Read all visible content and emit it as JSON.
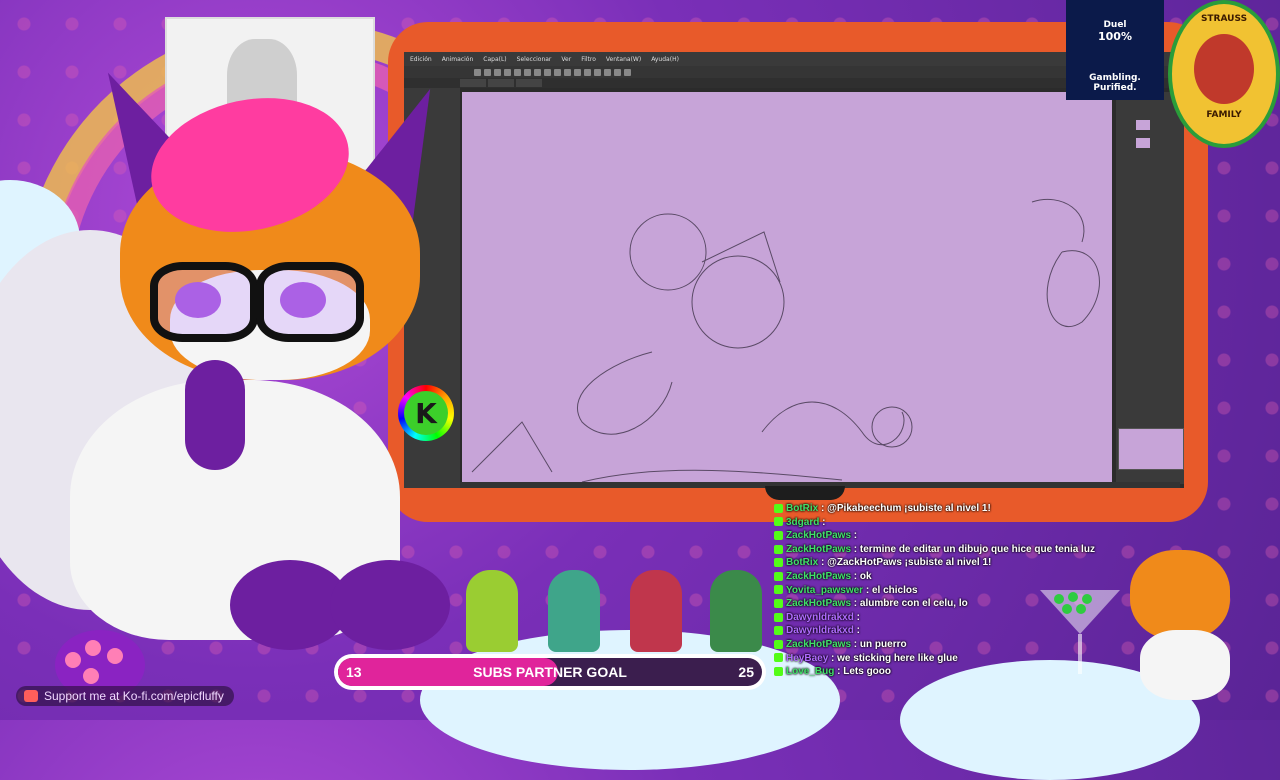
{
  "colors": {
    "accent": "#e0249b",
    "frame": "#e85a2a",
    "canvas": "#c7a4d8",
    "chat_user": "#40e06a"
  },
  "reference_card": {
    "icon": "wolf-sketch-icon"
  },
  "app": {
    "menu": [
      "Edición",
      "Animación",
      "Capa(L)",
      "Seleccionar",
      "Ver",
      "Filtro",
      "Ventana(W)",
      "Ayuda(H)"
    ]
  },
  "kick_badge": {
    "letter": "K"
  },
  "sponsor": {
    "name": "Duel",
    "percent": "100%",
    "tagline1": "Gambling.",
    "tagline2": "Purified."
  },
  "team_badge": {
    "top": "STRAUSS",
    "bottom": "FAMILY"
  },
  "goal": {
    "current": "13",
    "label": "SUBS PARTNER GOAL",
    "target": "25",
    "progress": 0.52
  },
  "kofi": {
    "text": "Support me at Ko-fi.com/epicfluffy"
  },
  "chat": [
    {
      "user": "BotRix",
      "text": ": @Pikabeechum ¡subiste al nivel 1!"
    },
    {
      "user": "3dgard",
      "text": ":"
    },
    {
      "user": "ZackHotPaws",
      "text": ":"
    },
    {
      "user": "ZackHotPaws",
      "text": ": termine de editar un dibujo que hice que tenia luz"
    },
    {
      "user": "BotRix",
      "text": ": @ZackHotPaws ¡subiste al nivel 1!"
    },
    {
      "user": "ZackHotPaws",
      "text": ": ok"
    },
    {
      "user": "Yovita_pawswer",
      "text": ": el chiclos"
    },
    {
      "user": "ZackHotPaws",
      "text": ": alumbre con el celu, lo"
    },
    {
      "user": "Dawynldrakxd",
      "text": ":"
    },
    {
      "user": "Dawynldrakxd",
      "text": ":"
    },
    {
      "user": "ZackHotPaws",
      "text": ": un puerro"
    },
    {
      "user": "HeyBaey",
      "text": ": we sticking here like glue"
    },
    {
      "user": "Love_Bug",
      "text": ": Lets gooo"
    }
  ]
}
